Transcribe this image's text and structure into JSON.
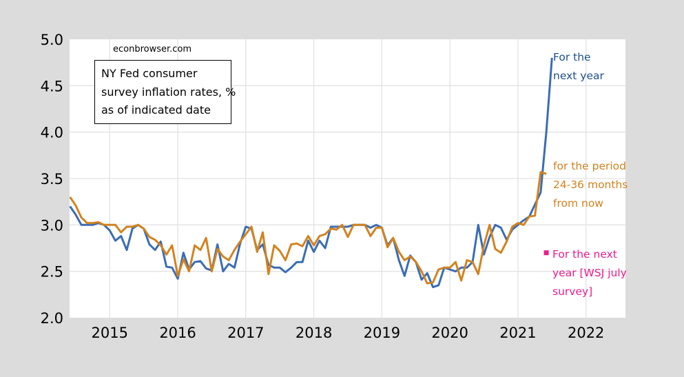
{
  "chart_data": {
    "type": "line",
    "title": "NY Fed consumer survey inflation rates, % as of indicated date",
    "title_lines": [
      "NY Fed consumer",
      "survey inflation rates, %",
      "as of indicated date"
    ],
    "watermark": "econbrowser.com",
    "xlabel": "",
    "ylabel": "",
    "x_start": "2014-06",
    "x_frequency": "monthly",
    "xlim": [
      2014.41,
      2022.58
    ],
    "ylim": [
      2.0,
      5.0
    ],
    "yticks": [
      "2.0",
      "2.5",
      "3.0",
      "3.5",
      "4.0",
      "4.5",
      "5.0"
    ],
    "ytick_values": [
      2.0,
      2.5,
      3.0,
      3.5,
      4.0,
      4.5,
      5.0
    ],
    "xticks": [
      "2015",
      "2016",
      "2017",
      "2018",
      "2019",
      "2020",
      "2021",
      "2022"
    ],
    "xtick_values": [
      2015,
      2016,
      2017,
      2018,
      2019,
      2020,
      2021,
      2022
    ],
    "grid": true,
    "series": [
      {
        "name": "For the next year",
        "label_lines": [
          "For the",
          "next year"
        ],
        "color": "#3a6cb4",
        "label_color": "#1f4e8c",
        "values": [
          3.2,
          3.11,
          3.0,
          3.0,
          3.0,
          3.02,
          3.0,
          2.94,
          2.83,
          2.88,
          2.73,
          2.96,
          3.0,
          2.96,
          2.79,
          2.73,
          2.82,
          2.55,
          2.54,
          2.42,
          2.7,
          2.52,
          2.6,
          2.61,
          2.53,
          2.51,
          2.79,
          2.5,
          2.58,
          2.54,
          2.8,
          2.98,
          2.96,
          2.73,
          2.79,
          2.57,
          2.54,
          2.54,
          2.49,
          2.54,
          2.6,
          2.6,
          2.83,
          2.71,
          2.83,
          2.75,
          2.98,
          2.98,
          2.98,
          2.98,
          3.0,
          3.0,
          3.0,
          2.97,
          3.0,
          2.97,
          2.78,
          2.86,
          2.62,
          2.45,
          2.67,
          2.6,
          2.41,
          2.48,
          2.33,
          2.35,
          2.54,
          2.52,
          2.5,
          2.54,
          2.54,
          2.6,
          3.0,
          2.68,
          2.87,
          3.0,
          2.97,
          2.84,
          2.95,
          3.0,
          3.05,
          3.09,
          3.22,
          3.35,
          4.0,
          4.8
        ]
      },
      {
        "name": "for the period 24-36 months from now",
        "label_lines": [
          "for the period",
          "24-36 months",
          "from now"
        ],
        "color": "#d2821e",
        "label_color": "#d2821e",
        "values": [
          3.3,
          3.21,
          3.08,
          3.02,
          3.02,
          3.03,
          3.0,
          3.0,
          3.0,
          2.92,
          2.98,
          2.98,
          3.0,
          2.96,
          2.87,
          2.84,
          2.78,
          2.68,
          2.78,
          2.45,
          2.63,
          2.5,
          2.78,
          2.73,
          2.86,
          2.5,
          2.74,
          2.66,
          2.62,
          2.73,
          2.82,
          2.9,
          2.98,
          2.71,
          2.92,
          2.47,
          2.78,
          2.72,
          2.62,
          2.79,
          2.8,
          2.77,
          2.88,
          2.78,
          2.88,
          2.9,
          2.96,
          2.95,
          3.0,
          2.87,
          3.0,
          3.0,
          3.0,
          2.88,
          2.97,
          2.97,
          2.76,
          2.86,
          2.71,
          2.62,
          2.66,
          2.6,
          2.5,
          2.37,
          2.38,
          2.52,
          2.54,
          2.54,
          2.6,
          2.4,
          2.62,
          2.6,
          2.47,
          2.78,
          3.0,
          2.74,
          2.7,
          2.82,
          2.98,
          3.02,
          3.0,
          3.09,
          3.1,
          3.57,
          3.55
        ]
      }
    ],
    "points": [
      {
        "name": "For the next year [WSJ july survey]",
        "label_lines": [
          "For the next",
          "year [WSJ july",
          "survey]"
        ],
        "color": "#ec1c8c",
        "x": "2021-06",
        "value": 2.7
      }
    ]
  }
}
